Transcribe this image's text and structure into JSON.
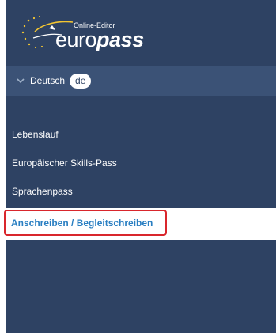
{
  "logo": {
    "small_text": "Online-Editor",
    "word_euro": "euro",
    "word_pass": "pass"
  },
  "language": {
    "label": "Deutsch",
    "code": "de",
    "icon": "chevron-down-icon"
  },
  "nav": {
    "items": [
      {
        "label": "Lebenslauf"
      },
      {
        "label": "Europäischer Skills-Pass"
      },
      {
        "label": "Sprachenpass"
      }
    ],
    "active": {
      "label": "Anschreiben / Begleitschreiben"
    }
  },
  "colors": {
    "sidebar": "#2e4263",
    "lang_bar": "#3b5276",
    "active_text": "#2a7fc2",
    "highlight_border": "#d9262c"
  }
}
